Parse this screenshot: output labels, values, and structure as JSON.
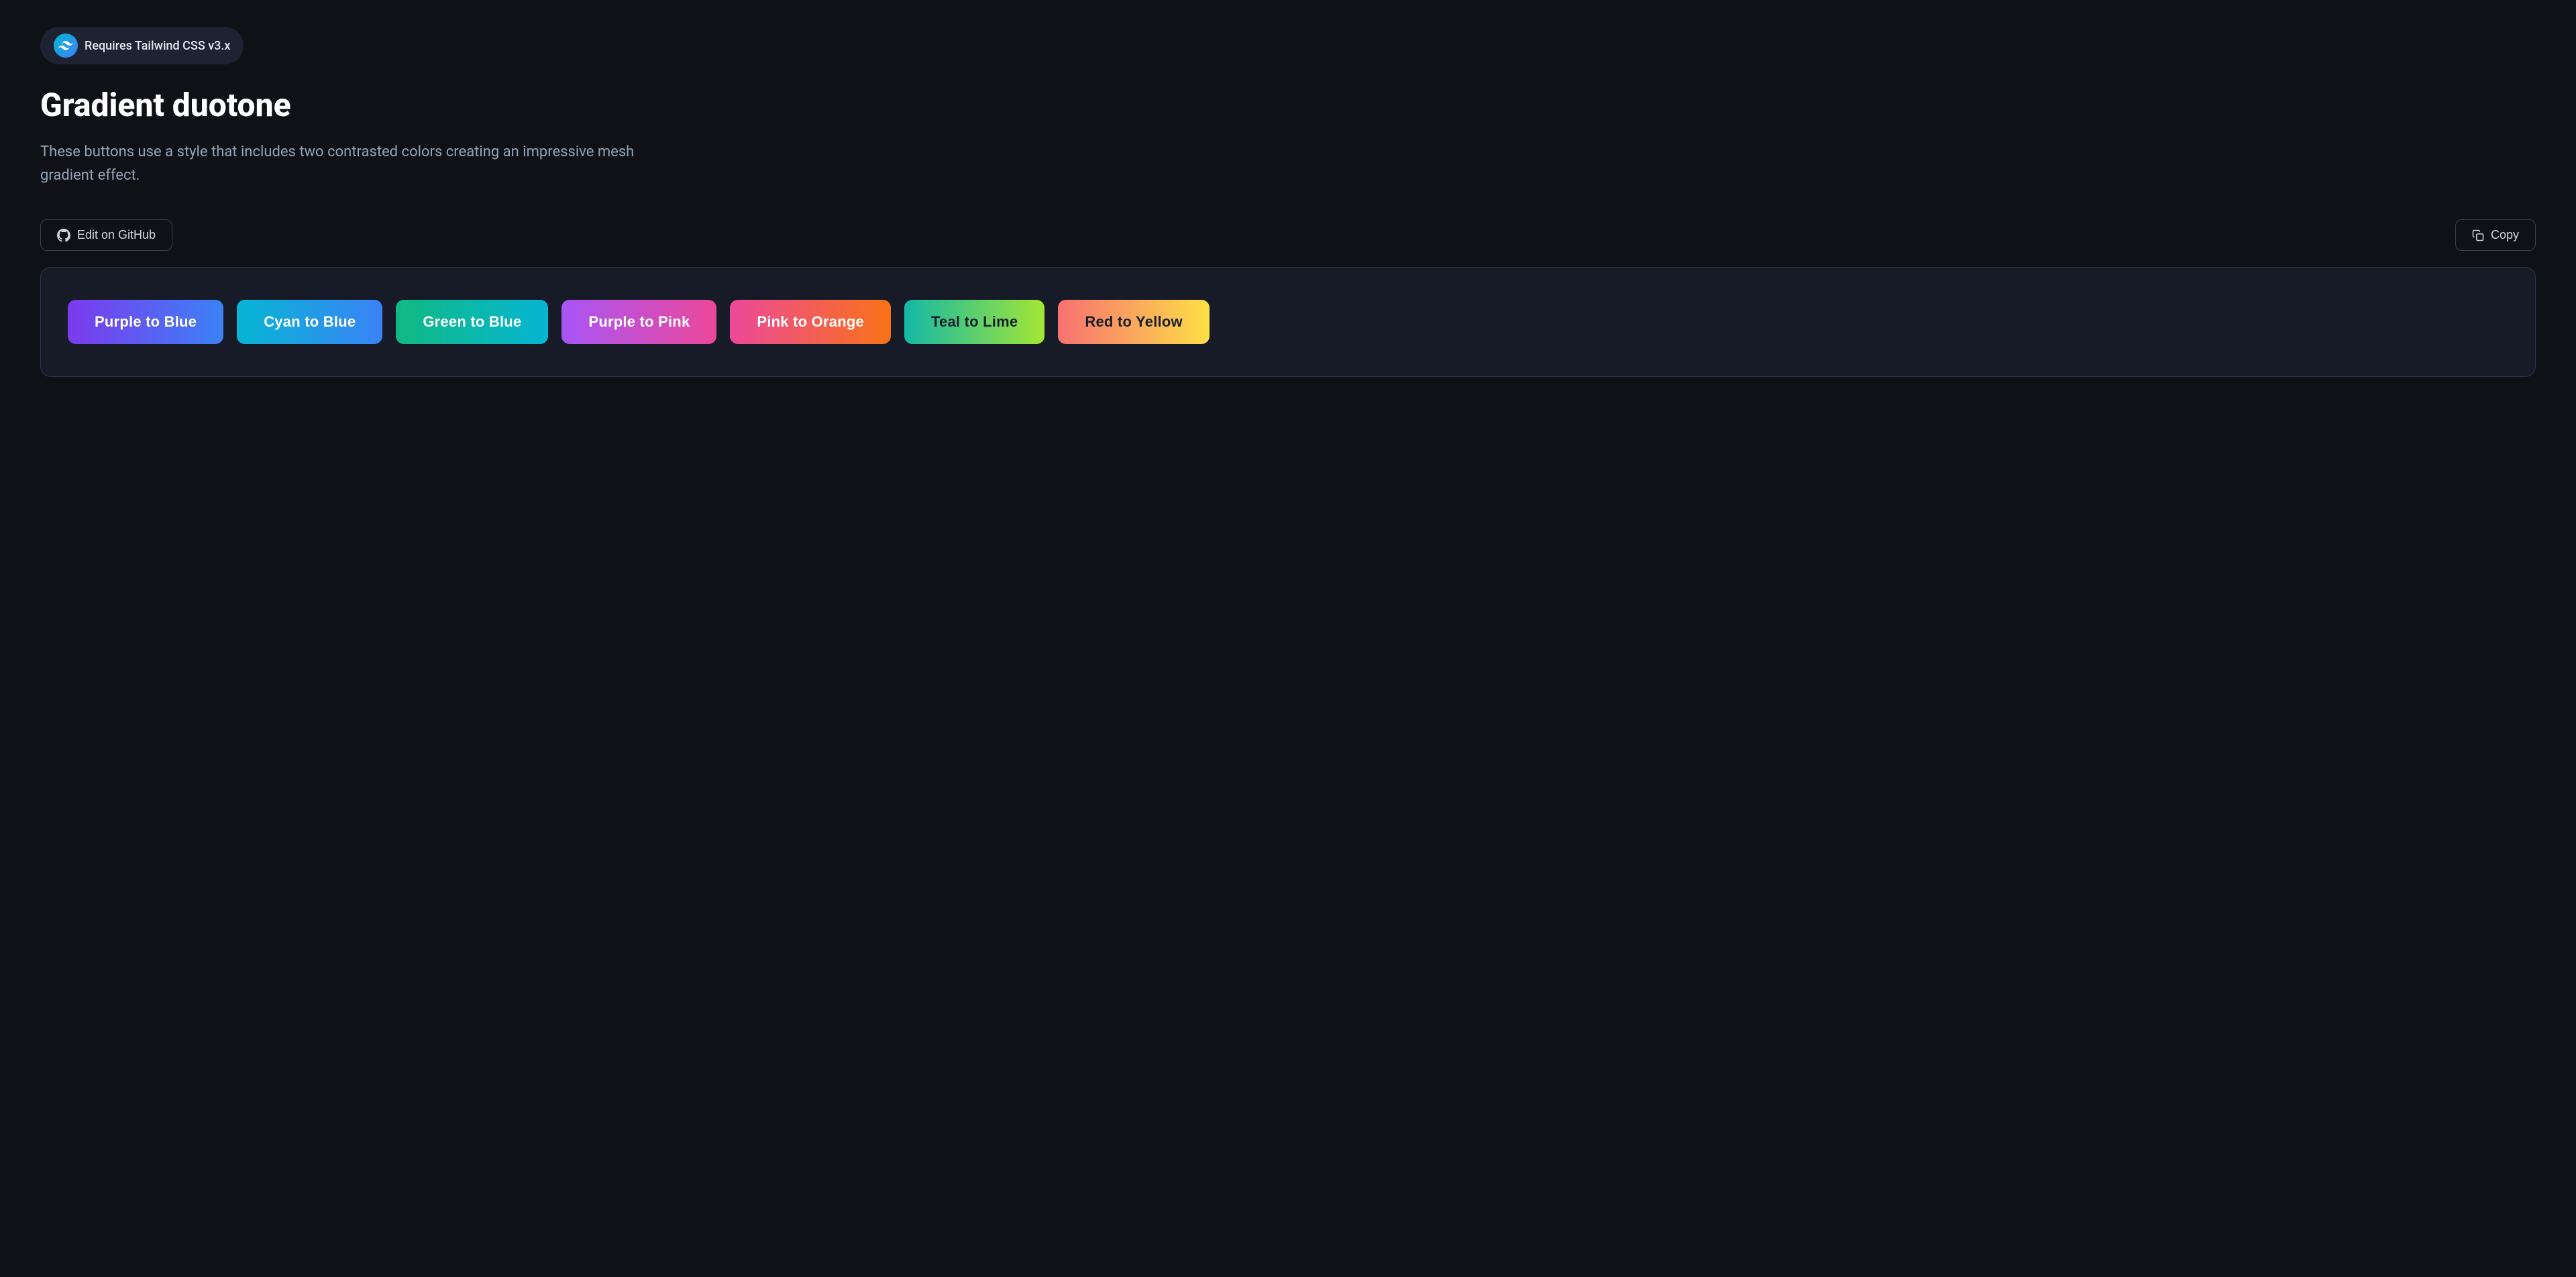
{
  "badge": {
    "text": "Requires Tailwind CSS v3.x"
  },
  "title": "Gradient duotone",
  "description": "These buttons use a style that includes two contrasted colors creating an impressive mesh gradient effect.",
  "toolbar": {
    "edit_label": "Edit on GitHub",
    "copy_label": "Copy"
  },
  "buttons": [
    {
      "id": "purple-blue",
      "label": "Purple to Blue",
      "class": "btn-purple-blue",
      "dark_text": false
    },
    {
      "id": "cyan-blue",
      "label": "Cyan to Blue",
      "class": "btn-cyan-blue",
      "dark_text": false
    },
    {
      "id": "green-blue",
      "label": "Green to Blue",
      "class": "btn-green-blue",
      "dark_text": false
    },
    {
      "id": "purple-pink",
      "label": "Purple to Pink",
      "class": "btn-purple-pink",
      "dark_text": false
    },
    {
      "id": "pink-orange",
      "label": "Pink to Orange",
      "class": "btn-pink-orange",
      "dark_text": false
    },
    {
      "id": "teal-lime",
      "label": "Teal to Lime",
      "class": "btn-teal-lime",
      "dark_text": true
    },
    {
      "id": "red-yellow",
      "label": "Red to Yellow",
      "class": "btn-red-yellow",
      "dark_text": true
    }
  ]
}
